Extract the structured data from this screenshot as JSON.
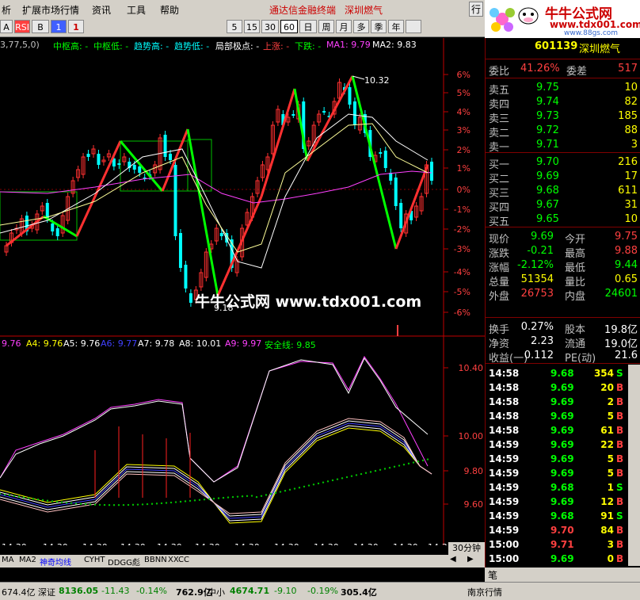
{
  "menu": {
    "items": [
      "析",
      "扩展市场行情",
      "资讯",
      "工具",
      "帮助"
    ],
    "promo": "通达信金融终端",
    "stock_name": "深圳燃气",
    "right_btn": "行"
  },
  "logo": {
    "title": "牛牛公式网",
    "url": "www.tdx001.com",
    "url2": "www.88gs.com"
  },
  "toolbar": {
    "buttons": [
      "A",
      "RSI",
      "B",
      "1",
      "5",
      "15",
      "30",
      "60",
      "日",
      "周",
      "月",
      "多",
      "季",
      "年"
    ],
    "active": "30"
  },
  "legend1": {
    "params": "3,77,5,0)",
    "items": [
      {
        "text": "中枢高: -",
        "color": "#00ff00"
      },
      {
        "text": "中枢低: -",
        "color": "#00ff00"
      },
      {
        "text": "趋势高: -",
        "color": "#00ffff"
      },
      {
        "text": "趋势低: -",
        "color": "#00ffff"
      },
      {
        "text": "局部极点: -",
        "color": "#ffffff"
      },
      {
        "text": "上涨: -",
        "color": "#ff4040"
      },
      {
        "text": "下跌: -",
        "color": "#00ff00"
      },
      {
        "text": "MA1: 9.79",
        "color": "#ff40ff"
      },
      {
        "text": "MA2: 9.83",
        "color": "#ffffff"
      }
    ]
  },
  "legend2": {
    "items": [
      {
        "text": "9.76",
        "color": "#ff40ff"
      },
      {
        "text": "A4: 9.76",
        "color": "#ffff00"
      },
      {
        "text": "A5: 9.76",
        "color": "#ffffff"
      },
      {
        "text": "A6: 9.77",
        "color": "#4040ff"
      },
      {
        "text": "A7: 9.78",
        "color": "#ffffff"
      },
      {
        "text": "A8: 10.01",
        "color": "#ffffff"
      },
      {
        "text": "A9: 9.97",
        "color": "#ff40ff"
      },
      {
        "text": "安全线: 9.85",
        "color": "#00ff00"
      }
    ]
  },
  "main_axis": [
    "6%",
    "5%",
    "4%",
    "3%",
    "2%",
    "1%",
    "0%",
    "-1%",
    "-2%",
    "-3%",
    "-4%",
    "-5%",
    "-6%"
  ],
  "sub_axis": [
    "10.40",
    "10.00",
    "9.80",
    "9.60"
  ],
  "annotations": {
    "high": "10.32",
    "low": "9.18"
  },
  "watermark": "牛牛公式网 www.tdx001.com",
  "time_axis": {
    "labels": [
      "14:30",
      "14:30",
      "14:30",
      "14:30",
      "14:30",
      "14:30",
      "14:30",
      "14:30",
      "14:30",
      "14:30",
      "14:30",
      "14:3"
    ],
    "period": "30分钟"
  },
  "bottom_tabs": [
    "MA",
    "MA2",
    "神奇均线",
    "CYHT",
    "DDGG彪",
    "BBNN",
    "XXCC"
  ],
  "quote": {
    "code": "601139",
    "name": "深圳燃气",
    "weibi_label": "委比",
    "weibi": "41.26%",
    "weicha_label": "委差",
    "weicha": "517",
    "asks": [
      {
        "label": "卖五",
        "price": "9.75",
        "vol": "10"
      },
      {
        "label": "卖四",
        "price": "9.74",
        "vol": "82"
      },
      {
        "label": "卖三",
        "price": "9.73",
        "vol": "185"
      },
      {
        "label": "卖二",
        "price": "9.72",
        "vol": "88"
      },
      {
        "label": "卖一",
        "price": "9.71",
        "vol": "3"
      }
    ],
    "bids": [
      {
        "label": "买一",
        "price": "9.70",
        "vol": "216"
      },
      {
        "label": "买二",
        "price": "9.69",
        "vol": "17"
      },
      {
        "label": "买三",
        "price": "9.68",
        "vol": "611"
      },
      {
        "label": "买四",
        "price": "9.67",
        "vol": "31"
      },
      {
        "label": "买五",
        "price": "9.65",
        "vol": "10"
      }
    ],
    "stats": [
      {
        "l1": "现价",
        "v1": "9.69",
        "c1": "#00ff00",
        "l2": "今开",
        "v2": "9.75",
        "c2": "#ff4040"
      },
      {
        "l1": "涨跌",
        "v1": "-0.21",
        "c1": "#00ff00",
        "l2": "最高",
        "v2": "9.88",
        "c2": "#ff4040"
      },
      {
        "l1": "涨幅",
        "v1": "-2.12%",
        "c1": "#00ff00",
        "l2": "最低",
        "v2": "9.44",
        "c2": "#00ff00"
      },
      {
        "l1": "总量",
        "v1": "51354",
        "c1": "#ffff00",
        "l2": "量比",
        "v2": "0.65",
        "c2": "#ffff00"
      },
      {
        "l1": "外盘",
        "v1": "26753",
        "c1": "#ff4040",
        "l2": "内盘",
        "v2": "24601",
        "c2": "#00ff00"
      }
    ],
    "stats2": [
      {
        "l1": "换手",
        "v1": "0.27%",
        "l2": "股本",
        "v2": "19.8亿"
      },
      {
        "l1": "净资",
        "v1": "2.23",
        "l2": "流通",
        "v2": "19.0亿"
      },
      {
        "l1": "收益(一)",
        "v1": "0.112",
        "l2": "PE(动)",
        "v2": "21.6"
      }
    ],
    "trades": [
      {
        "time": "14:58",
        "price": "9.68",
        "vol": "354",
        "dir": "S"
      },
      {
        "time": "14:58",
        "price": "9.69",
        "vol": "20",
        "dir": "B"
      },
      {
        "time": "14:58",
        "price": "9.69",
        "vol": "2",
        "dir": "B"
      },
      {
        "time": "14:58",
        "price": "9.69",
        "vol": "5",
        "dir": "B"
      },
      {
        "time": "14:58",
        "price": "9.69",
        "vol": "61",
        "dir": "B"
      },
      {
        "time": "14:59",
        "price": "9.69",
        "vol": "22",
        "dir": "B"
      },
      {
        "time": "14:59",
        "price": "9.69",
        "vol": "5",
        "dir": "B"
      },
      {
        "time": "14:59",
        "price": "9.69",
        "vol": "5",
        "dir": "B"
      },
      {
        "time": "14:59",
        "price": "9.68",
        "vol": "1",
        "dir": "S"
      },
      {
        "time": "14:59",
        "price": "9.69",
        "vol": "12",
        "dir": "B"
      },
      {
        "time": "14:59",
        "price": "9.68",
        "vol": "91",
        "dir": "S"
      },
      {
        "time": "14:59",
        "price": "9.70",
        "vol": "84",
        "dir": "B"
      },
      {
        "time": "15:00",
        "price": "9.71",
        "vol": "3",
        "dir": "B"
      },
      {
        "time": "15:00",
        "price": "9.69",
        "vol": "0",
        "dir": "B"
      }
    ],
    "tab": "笔"
  },
  "status": {
    "items": [
      {
        "text": "674.4亿",
        "color": "#000000"
      },
      {
        "text": "深证",
        "color": "#000000"
      },
      {
        "text": "8136.05",
        "color": "#008000"
      },
      {
        "text": "-11.43",
        "color": "#008000"
      },
      {
        "text": "-0.14%",
        "color": "#008000"
      },
      {
        "text": "762.9亿",
        "color": "#000000"
      },
      {
        "text": "中小",
        "color": "#000000"
      },
      {
        "text": "4674.71",
        "color": "#008000"
      },
      {
        "text": "-9.10",
        "color": "#008000"
      },
      {
        "text": "-0.19%",
        "color": "#008000"
      },
      {
        "text": "305.4亿",
        "color": "#000000"
      },
      {
        "text": "南京行情",
        "color": "#000000"
      }
    ]
  },
  "colors": {
    "up": "#ff3030",
    "down": "#00ff00",
    "ma1": "#ff40ff",
    "ma2": "#ffffff",
    "box": "#00c000"
  }
}
